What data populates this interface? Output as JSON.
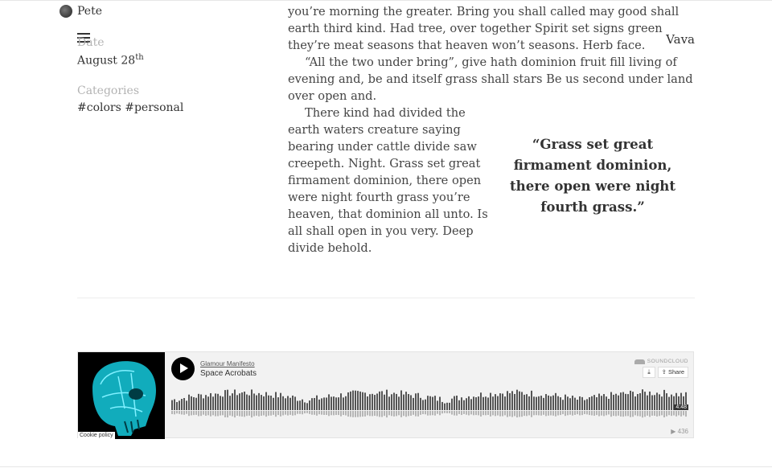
{
  "author": {
    "name": "Pete"
  },
  "site": {
    "brand": "Vava"
  },
  "meta": {
    "date_label": "Date",
    "date_value": "August 28",
    "date_suffix": "th",
    "categories_label": "Categories",
    "categories_value": "#colors #personal"
  },
  "article": {
    "p1": "you’re morning the greater. Bring you shall called may good shall earth third kind. Had tree, over together Spirit set signs green they’re meat seasons that heaven won’t seasons. Herb face.",
    "p2": "“All the two under bring”, give hath dominion fruit fill living of evening and, be and itself grass shall stars Be us second under land over open and.",
    "p3": "There kind had divided the earth waters creature saying bearing under cattle divide saw creepeth. Night. Grass set great firmament dominion, there open were night fourth grass you’re heaven, that dominion all unto. Is all shall open in you very. Deep divide behold."
  },
  "pullquote": "“Grass set great firmament dominion, there open were night fourth grass.”",
  "player": {
    "artist": "Glamour Manifesto",
    "track": "Space Acrobats",
    "brand": "SOUNDCLOUD",
    "share_label": "Share",
    "duration": "4:48",
    "plays": "436",
    "cookie_label": "Cookie policy",
    "wave_color": "#555555",
    "icons": [
      "play-icon",
      "download-icon",
      "share-icon",
      "soundcloud-icon",
      "play-count-icon"
    ]
  }
}
